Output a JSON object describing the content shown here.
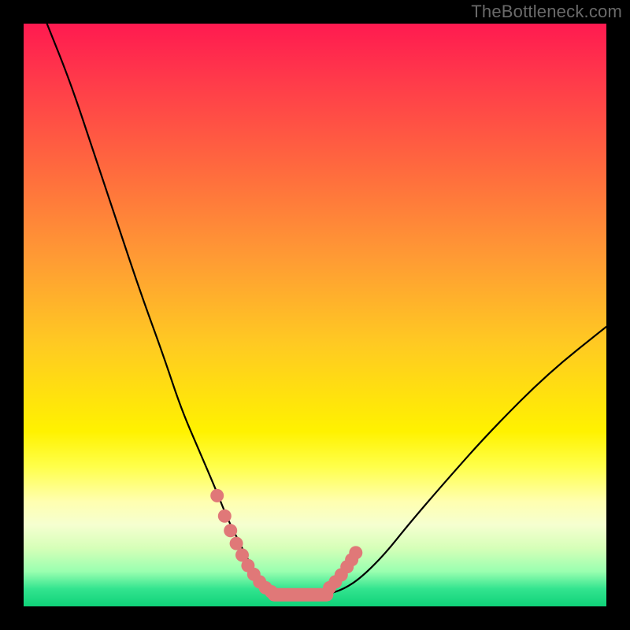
{
  "watermark": "TheBottleneck.com",
  "chart_data": {
    "type": "line",
    "title": "",
    "xlabel": "",
    "ylabel": "",
    "xlim": [
      0,
      100
    ],
    "ylim": [
      0,
      100
    ],
    "series": [
      {
        "name": "bottleneck-curve",
        "x": [
          4,
          8,
          12,
          16,
          20,
          24,
          27,
          30,
          33,
          35,
          37,
          39,
          41,
          43,
          45,
          47,
          52,
          55,
          58,
          62,
          66,
          72,
          80,
          90,
          100
        ],
        "y": [
          100,
          90,
          78,
          66,
          54,
          43,
          34,
          27,
          20,
          15,
          11,
          7,
          4,
          2.5,
          2,
          2,
          2,
          3,
          5,
          9,
          14,
          21,
          30,
          40,
          48
        ],
        "color": "#000000"
      },
      {
        "name": "highlight-dots-left",
        "x": [
          33.2,
          34.5,
          35.5,
          36.5,
          37.5,
          38.5,
          39.5,
          40.5,
          41.5,
          42.5
        ],
        "y": [
          19,
          15.5,
          13,
          10.8,
          8.8,
          7,
          5.5,
          4.2,
          3.2,
          2.5
        ],
        "color": "#e07878"
      },
      {
        "name": "highlight-dots-right",
        "x": [
          52.5,
          53.5,
          54.5,
          55.5,
          56.3,
          57.0
        ],
        "y": [
          3.2,
          4.2,
          5.4,
          6.8,
          8.0,
          9.2
        ],
        "color": "#e07878"
      },
      {
        "name": "flat-bottom",
        "x": [
          43,
          52
        ],
        "y": [
          2,
          2
        ],
        "color": "#e07878"
      }
    ],
    "gradient_stops": [
      {
        "pos": 0,
        "color": "#ff1a50"
      },
      {
        "pos": 25,
        "color": "#ff6a3e"
      },
      {
        "pos": 55,
        "color": "#ffca22"
      },
      {
        "pos": 82,
        "color": "#ffffb0"
      },
      {
        "pos": 100,
        "color": "#0fd279"
      }
    ]
  }
}
